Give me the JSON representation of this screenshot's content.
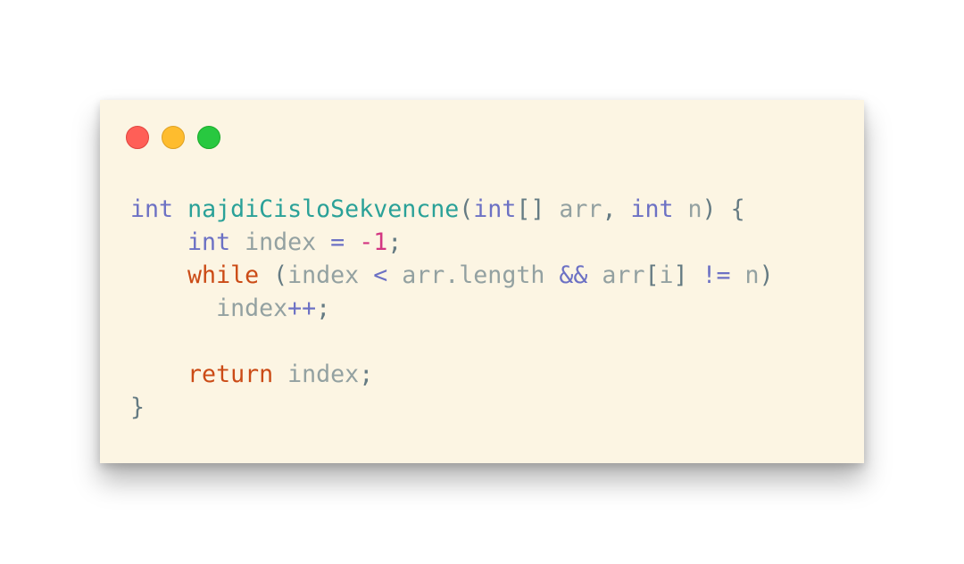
{
  "window": {
    "controls": [
      {
        "name": "close",
        "color": "#ff5f57"
      },
      {
        "name": "minimize",
        "color": "#febc2e"
      },
      {
        "name": "zoom",
        "color": "#28c840"
      }
    ]
  },
  "colors": {
    "background": "#fcf5e3",
    "type": "#6c71c4",
    "function": "#2aa198",
    "keyword": "#cb4b16",
    "identifier": "#93a1a1",
    "number": "#d33682",
    "operator": "#6c71c4",
    "punctuation": "#657b83"
  },
  "code": {
    "lines": [
      [
        {
          "t": "int",
          "k": "type"
        },
        {
          "t": " ",
          "k": "identifier"
        },
        {
          "t": "najdiCisloSekvencne",
          "k": "function"
        },
        {
          "t": "(",
          "k": "punctuation"
        },
        {
          "t": "int",
          "k": "type"
        },
        {
          "t": "[] ",
          "k": "punctuation"
        },
        {
          "t": "arr",
          "k": "identifier"
        },
        {
          "t": ", ",
          "k": "punctuation"
        },
        {
          "t": "int",
          "k": "type"
        },
        {
          "t": " ",
          "k": "identifier"
        },
        {
          "t": "n",
          "k": "identifier"
        },
        {
          "t": ") {",
          "k": "punctuation"
        }
      ],
      [
        {
          "t": "    ",
          "k": "identifier"
        },
        {
          "t": "int",
          "k": "type"
        },
        {
          "t": " index ",
          "k": "identifier"
        },
        {
          "t": "=",
          "k": "operator"
        },
        {
          "t": " ",
          "k": "identifier"
        },
        {
          "t": "-",
          "k": "number"
        },
        {
          "t": "1",
          "k": "number"
        },
        {
          "t": ";",
          "k": "punctuation"
        }
      ],
      [
        {
          "t": "    ",
          "k": "identifier"
        },
        {
          "t": "while",
          "k": "keyword"
        },
        {
          "t": " (",
          "k": "punctuation"
        },
        {
          "t": "index ",
          "k": "identifier"
        },
        {
          "t": "<",
          "k": "operator"
        },
        {
          "t": " arr.length ",
          "k": "identifier"
        },
        {
          "t": "&&",
          "k": "operator"
        },
        {
          "t": " arr",
          "k": "identifier"
        },
        {
          "t": "[",
          "k": "punctuation"
        },
        {
          "t": "i",
          "k": "identifier"
        },
        {
          "t": "] ",
          "k": "punctuation"
        },
        {
          "t": "!=",
          "k": "operator"
        },
        {
          "t": " n",
          "k": "identifier"
        },
        {
          "t": ")",
          "k": "punctuation"
        }
      ],
      [
        {
          "t": "      ",
          "k": "identifier"
        },
        {
          "t": "index",
          "k": "identifier"
        },
        {
          "t": "++",
          "k": "operator"
        },
        {
          "t": ";",
          "k": "punctuation"
        }
      ],
      [],
      [
        {
          "t": "    ",
          "k": "identifier"
        },
        {
          "t": "return",
          "k": "keyword"
        },
        {
          "t": " index",
          "k": "identifier"
        },
        {
          "t": ";",
          "k": "punctuation"
        }
      ],
      [
        {
          "t": "}",
          "k": "punctuation"
        }
      ]
    ]
  }
}
